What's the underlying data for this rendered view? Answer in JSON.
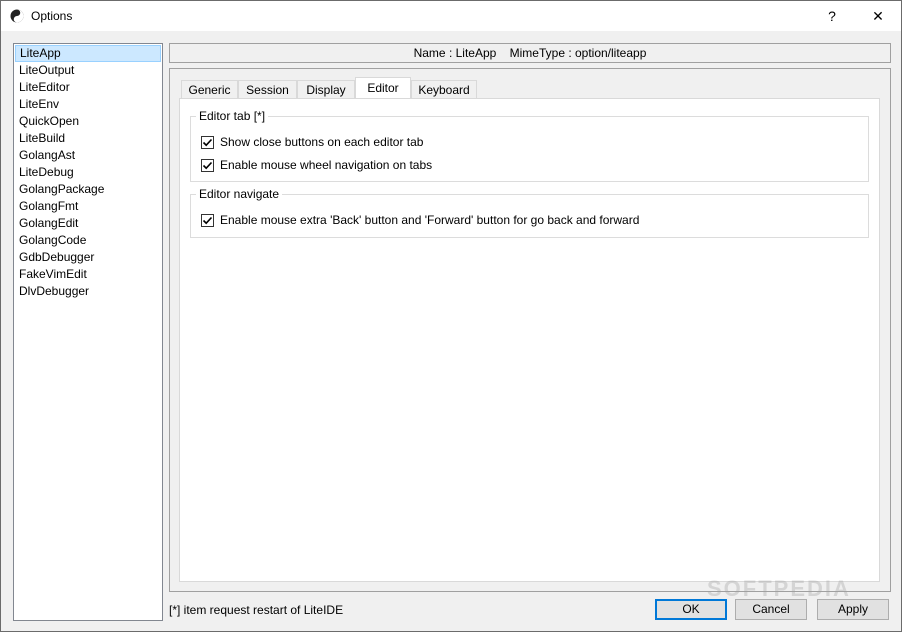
{
  "window": {
    "title": "Options",
    "help_glyph": "?",
    "close_glyph": "✕"
  },
  "sidebar": {
    "items": [
      {
        "label": "LiteApp",
        "selected": true
      },
      {
        "label": "LiteOutput"
      },
      {
        "label": "LiteEditor"
      },
      {
        "label": "LiteEnv"
      },
      {
        "label": "QuickOpen"
      },
      {
        "label": "LiteBuild"
      },
      {
        "label": "GolangAst"
      },
      {
        "label": "LiteDebug"
      },
      {
        "label": "GolangPackage"
      },
      {
        "label": "GolangFmt"
      },
      {
        "label": "GolangEdit"
      },
      {
        "label": "GolangCode"
      },
      {
        "label": "GdbDebugger"
      },
      {
        "label": "FakeVimEdit"
      },
      {
        "label": "DlvDebugger"
      }
    ]
  },
  "header": {
    "text": "Name : LiteApp    MimeType : option/liteapp"
  },
  "tabs": [
    {
      "label": "Generic"
    },
    {
      "label": "Session"
    },
    {
      "label": "Display"
    },
    {
      "label": "Editor",
      "active": true
    },
    {
      "label": "Keyboard"
    }
  ],
  "editor_tab_group": {
    "title": "Editor tab [*]",
    "options": [
      {
        "label": "Show close buttons on each editor tab",
        "checked": true
      },
      {
        "label": "Enable mouse wheel navigation on tabs",
        "checked": true
      }
    ]
  },
  "editor_navigate_group": {
    "title": "Editor navigate",
    "options": [
      {
        "label": "Enable mouse extra 'Back' button and 'Forward' button for go back and forward",
        "checked": true
      }
    ]
  },
  "footer": {
    "note": "[*] item request restart of LiteIDE",
    "ok_label": "OK",
    "cancel_label": "Cancel",
    "apply_label": "Apply"
  },
  "watermark": "SOFTPEDIA",
  "colors": {
    "selection_bg": "#cce8ff",
    "default_button_border": "#0078d7"
  }
}
